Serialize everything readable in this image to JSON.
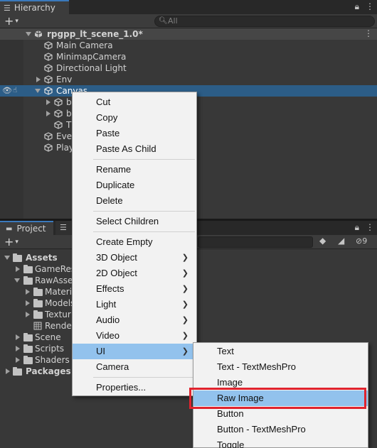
{
  "hierarchy": {
    "tab_label": "Hierarchy",
    "add_label": "+",
    "search_placeholder": "All",
    "scene_name": "rpgpp_lt_scene_1.0*",
    "items": [
      {
        "label": "Main Camera"
      },
      {
        "label": "MinimapCamera"
      },
      {
        "label": "Directional Light"
      },
      {
        "label": "Env"
      },
      {
        "label": "Canvas"
      },
      {
        "label": "b"
      },
      {
        "label": "b"
      },
      {
        "label": "T"
      },
      {
        "label": "Eve"
      },
      {
        "label": "Play"
      }
    ]
  },
  "project": {
    "tab_label": "Project",
    "add_label": "+",
    "hidden_count": "9",
    "tree": [
      {
        "label": "Assets"
      },
      {
        "label": "GameRes"
      },
      {
        "label": "RawAsse"
      },
      {
        "label": "Materi"
      },
      {
        "label": "Models"
      },
      {
        "label": "Textur"
      },
      {
        "label": "Rende"
      },
      {
        "label": "Scene"
      },
      {
        "label": "Scripts"
      },
      {
        "label": "Shaders"
      },
      {
        "label": "Packages"
      }
    ]
  },
  "context_menu": {
    "items": [
      {
        "label": "Cut"
      },
      {
        "label": "Copy"
      },
      {
        "label": "Paste"
      },
      {
        "label": "Paste As Child"
      },
      {
        "label": "Rename"
      },
      {
        "label": "Duplicate"
      },
      {
        "label": "Delete"
      },
      {
        "label": "Select Children"
      },
      {
        "label": "Create Empty"
      },
      {
        "label": "3D Object"
      },
      {
        "label": "2D Object"
      },
      {
        "label": "Effects"
      },
      {
        "label": "Light"
      },
      {
        "label": "Audio"
      },
      {
        "label": "Video"
      },
      {
        "label": "UI"
      },
      {
        "label": "Camera"
      },
      {
        "label": "Properties..."
      }
    ],
    "highlighted": "UI"
  },
  "ui_submenu": {
    "items": [
      {
        "label": "Text"
      },
      {
        "label": "Text - TextMeshPro"
      },
      {
        "label": "Image"
      },
      {
        "label": "Raw Image"
      },
      {
        "label": "Button"
      },
      {
        "label": "Button - TextMeshPro"
      },
      {
        "label": "Toggle"
      }
    ],
    "highlighted": "Raw Image"
  },
  "colors": {
    "selection": "#2c5d87",
    "menu_highlight": "#92c2ed",
    "callout": "#e0232e"
  }
}
